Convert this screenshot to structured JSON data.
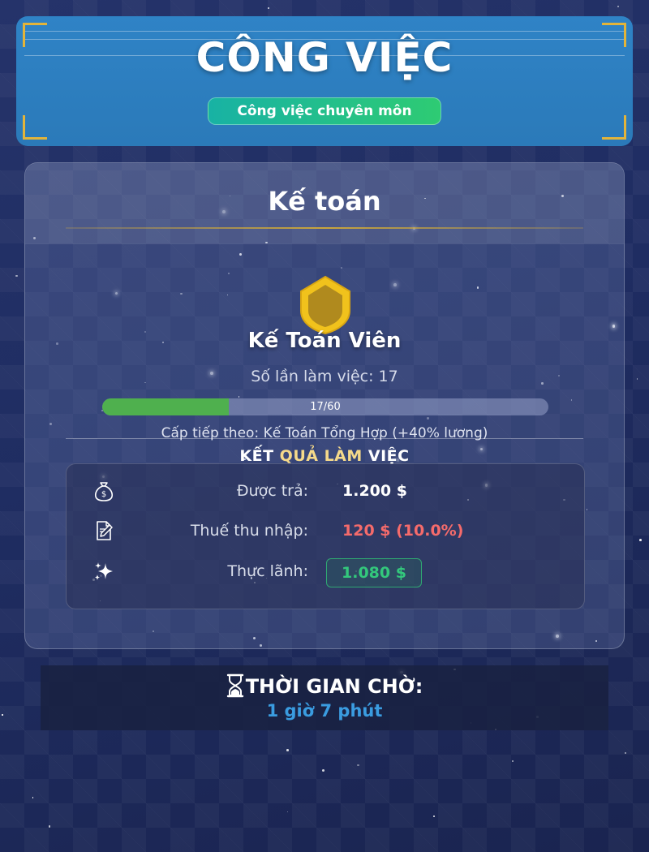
{
  "header": {
    "title": "CÔNG VIỆC",
    "subtitle": "Công việc chuyên môn"
  },
  "job": {
    "title": "Kế toán",
    "rank_name": "Kế Toán Viên",
    "work_count_label": "Số lần làm việc:",
    "work_count": "17",
    "progress_text": "17/60",
    "progress_fraction": 0.2833,
    "next_level": "Cấp tiếp theo: Kế Toán Tổng Hợp (+40% lương)"
  },
  "results": {
    "title_part1": "KẾT ",
    "title_part2": "QUẢ LÀM",
    "title_part3": " VIỆC",
    "rows": [
      {
        "icon": "money-bag-icon",
        "label": "Được trả:",
        "value": "1.200 $"
      },
      {
        "icon": "memo-icon",
        "label": "Thuế thu nhập:",
        "value": "120 $ (10.0%)"
      },
      {
        "icon": "sparkles-icon",
        "label": "Thực lãnh:",
        "value": "1.080 $"
      }
    ]
  },
  "cooldown": {
    "icon": "hourglass-icon",
    "label": "THỜI GIAN CHỜ:",
    "value": "1 giờ 7 phút"
  },
  "colors": {
    "header_blue": "#2f83c6",
    "accent_gold": "#e2b43a",
    "progress_green": "#4fb04e",
    "tax_red": "#f56b6b",
    "net_green": "#33c87c",
    "cooldown_blue": "#3a9ce0"
  }
}
